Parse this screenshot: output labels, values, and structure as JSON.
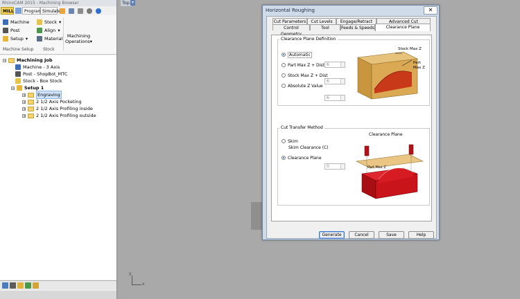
{
  "browser": {
    "title": "RhinoCAM 2015 - Machining Browser",
    "tabs": [
      "MILL",
      "Program",
      "Simulate"
    ],
    "ribbon": {
      "machine": "Machine",
      "post": "Post",
      "setup": "Setup",
      "stock": "Stock",
      "align": "Align",
      "material": "Material",
      "machining_ops": [
        "Machining",
        "Operations"
      ],
      "group_machine_setup": "Machine Setup",
      "group_stock": "Stock"
    },
    "tree": {
      "root": "Machining Job",
      "machine": "Machine - 3 Axis",
      "post": "Post - ShopBot_MTC",
      "stock": "Stock - Box Stock",
      "setup": "Setup 1",
      "ops": [
        "Engraving",
        "2 1/2 Axis Pocketing",
        "2 1/2 Axis Profiling inside",
        "2 1/2 Axis Profiling outside"
      ]
    }
  },
  "viewport": {
    "label": "Top",
    "axis_y": "y",
    "axis_x": "x"
  },
  "dialog": {
    "title": "Horizontal Roughing",
    "close": "✕",
    "tabs_row1": [
      "Cut Parameters",
      "Cut Levels",
      "Engage/Retract",
      "Advanced Cut Parameters"
    ],
    "tabs_row2": [
      "Control Geometry",
      "Tool",
      "Feeds & Speeds",
      "Clearance Plane"
    ],
    "active_tab": "Clearance Plane",
    "def_group": {
      "title": "Clearance Plane Definition",
      "options": [
        {
          "label": "Automatic",
          "selected": true
        },
        {
          "label": "Part Max Z + Dist",
          "value": "6"
        },
        {
          "label": "Stock Max Z + Dist",
          "value": "6"
        },
        {
          "label": "Absolute Z Value",
          "value": "6"
        }
      ],
      "diagram_labels": {
        "stock_max_z": "Stock Max Z",
        "part_max_z_1": "Part",
        "part_max_z_2": "Max Z"
      }
    },
    "transfer_group": {
      "title": "Cut Transfer Method",
      "skim": "Skim",
      "skim_clearance_label": "Skim Clearance (C)",
      "skim_clearance_value": "0",
      "clearance_plane": "Clearance Plane",
      "selected": "Clearance Plane",
      "diagram_labels": {
        "clearance_plane": "Clearance Plane",
        "part_max_z": "Part Max Z"
      }
    },
    "buttons": {
      "generate": "Generate",
      "cancel": "Cancel",
      "save": "Save",
      "help": "Help"
    }
  },
  "colors": {
    "accent": "#3b74c4",
    "stock_orange": "#e3b25a",
    "part_red": "#c8141a"
  }
}
